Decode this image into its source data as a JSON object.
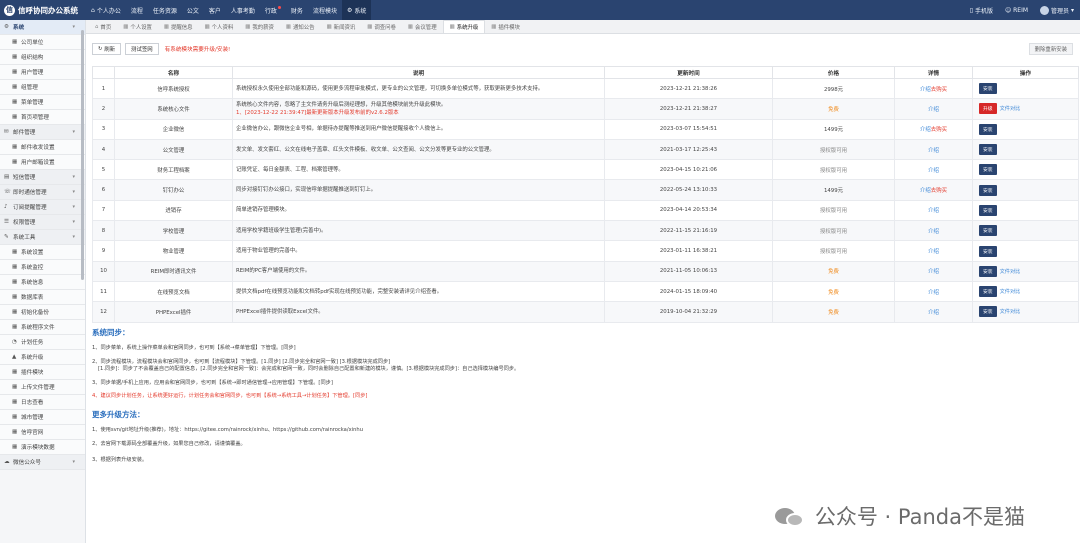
{
  "brand": {
    "name": "信呼协同办公系统",
    "logo_char": "信"
  },
  "topnav": [
    {
      "icon": "⌂",
      "label": "个人办公",
      "active": false
    },
    {
      "icon": "",
      "label": "流程",
      "active": false
    },
    {
      "icon": "",
      "label": "任务资源",
      "active": false
    },
    {
      "icon": "",
      "label": "公文",
      "active": false
    },
    {
      "icon": "",
      "label": "客户",
      "active": false
    },
    {
      "icon": "",
      "label": "人事考勤",
      "active": false
    },
    {
      "icon": "",
      "label": "行政",
      "active": false,
      "dot": true
    },
    {
      "icon": "",
      "label": "财务",
      "active": false
    },
    {
      "icon": "",
      "label": "流程模块",
      "active": false
    },
    {
      "icon": "⚙",
      "label": "系统",
      "active": true
    }
  ],
  "topright": {
    "mobile": "手机版",
    "reim": "REIM",
    "user": "管理员"
  },
  "sidebar": [
    {
      "type": "group",
      "icon": "⚙",
      "label": "系统",
      "active": true,
      "caret": "▾"
    },
    {
      "type": "sub",
      "icon": "▦",
      "label": "公司单位"
    },
    {
      "type": "sub",
      "icon": "▦",
      "label": "组织结构"
    },
    {
      "type": "sub",
      "icon": "▦",
      "label": "用户管理"
    },
    {
      "type": "sub",
      "icon": "▦",
      "label": "组管理"
    },
    {
      "type": "sub",
      "icon": "▦",
      "label": "菜单管理"
    },
    {
      "type": "sub",
      "icon": "▦",
      "label": "首页项管理"
    },
    {
      "type": "group",
      "icon": "✉",
      "label": "邮件管理",
      "caret": "▾"
    },
    {
      "type": "sub",
      "icon": "▦",
      "label": "邮件收发设置"
    },
    {
      "type": "sub",
      "icon": "▦",
      "label": "用户邮箱设置"
    },
    {
      "type": "group",
      "icon": "▤",
      "label": "短信管理",
      "caret": "▾"
    },
    {
      "type": "group",
      "icon": "☏",
      "label": "即时通信管理",
      "caret": "▾"
    },
    {
      "type": "group",
      "icon": "♪",
      "label": "订阅提醒管理",
      "caret": "▾"
    },
    {
      "type": "group",
      "icon": "☰",
      "label": "权限管理",
      "caret": "▾"
    },
    {
      "type": "group",
      "icon": "✎",
      "label": "系统工具",
      "caret": "▾"
    },
    {
      "type": "sub",
      "icon": "▦",
      "label": "系统设置"
    },
    {
      "type": "sub",
      "icon": "▦",
      "label": "系统监控"
    },
    {
      "type": "sub",
      "icon": "▦",
      "label": "系统信息"
    },
    {
      "type": "sub",
      "icon": "▦",
      "label": "数据库表"
    },
    {
      "type": "sub",
      "icon": "▦",
      "label": "初始化备份"
    },
    {
      "type": "sub",
      "icon": "▦",
      "label": "系统程序文件"
    },
    {
      "type": "sub",
      "icon": "◔",
      "label": "计划任务"
    },
    {
      "type": "sub",
      "icon": "▲",
      "label": "系统升级"
    },
    {
      "type": "sub",
      "icon": "▦",
      "label": "插件模块"
    },
    {
      "type": "sub",
      "icon": "▦",
      "label": "上传文件管理"
    },
    {
      "type": "sub",
      "icon": "▦",
      "label": "日志查看"
    },
    {
      "type": "sub",
      "icon": "▦",
      "label": "城市管理"
    },
    {
      "type": "sub",
      "icon": "▦",
      "label": "信呼官网"
    },
    {
      "type": "sub",
      "icon": "▦",
      "label": "演示模块数据"
    },
    {
      "type": "group",
      "icon": "☁",
      "label": "微信公众号",
      "caret": "▾"
    }
  ],
  "tabs": [
    {
      "icon": "⌂",
      "label": "首页",
      "active": false
    },
    {
      "icon": "▦",
      "label": "个人设置",
      "active": false
    },
    {
      "icon": "▦",
      "label": "提醒信息",
      "active": false
    },
    {
      "icon": "▦",
      "label": "个人资料",
      "active": false
    },
    {
      "icon": "▦",
      "label": "我的薪资",
      "active": false
    },
    {
      "icon": "▦",
      "label": "通知公告",
      "active": false
    },
    {
      "icon": "▦",
      "label": "新闻资讯",
      "active": false
    },
    {
      "icon": "▦",
      "label": "调查问卷",
      "active": false
    },
    {
      "icon": "▦",
      "label": "会议管理",
      "active": false
    },
    {
      "icon": "▦",
      "label": "系统升级",
      "active": true
    },
    {
      "icon": "▦",
      "label": "插件模块",
      "active": false
    }
  ],
  "toolbar": {
    "refresh_label": "刷新",
    "test_label": "测试签网",
    "warning": "有系统模块需要升级/安装!",
    "delete_label": "删除重新安装"
  },
  "table": {
    "headers": [
      "",
      "名称",
      "说明",
      "更新时间",
      "价格",
      "详情",
      "操作"
    ],
    "rows": [
      {
        "no": "1",
        "name": "信呼系统授权",
        "desc": "系统授权永久使用全部功能和源码，使用更多流程审批模式，更专业的公文管理，可切换多单位模式等，获取更新更多技术支持。",
        "note": "",
        "time": "2023-12-21 21:38:26",
        "price": "2998元",
        "price_type": "normal",
        "detail": "介绍",
        "buy": "去购买",
        "action": "安装",
        "compare": ""
      },
      {
        "no": "2",
        "name": "系统核心文件",
        "desc": "系统核心文件内容，忽略了主文件请务升级后测经理想，升级其他模块前先升级此模块。",
        "note": "1、[2023-12-22 21:39:47]最新更新版本升级发布前的v2.6.2版本",
        "time": "2023-12-21 21:38:27",
        "price": "免费",
        "price_type": "free",
        "detail": "介绍",
        "buy": "",
        "action": "升级",
        "compare": "文件对比"
      },
      {
        "no": "3",
        "name": "企业微信",
        "desc": "企业微信办公，跟微信企业号相，单据待办提醒等推送到用户微信提醒接收个人微信上。",
        "note": "",
        "time": "2023-03-07 15:54:51",
        "price": "1499元",
        "price_type": "normal",
        "detail": "介绍",
        "buy": "去购买",
        "action": "安装",
        "compare": ""
      },
      {
        "no": "4",
        "name": "公文管理",
        "desc": "发文单、发文套红、公文在线电子盖章、红头文件模板、收文单、公文查阅、公文分发等更专业的公文管理。",
        "note": "",
        "time": "2021-03-17 12:25:43",
        "price": "授权版可用",
        "price_type": "grey",
        "detail": "介绍",
        "buy": "",
        "action": "安装",
        "compare": ""
      },
      {
        "no": "5",
        "name": "财务工程档案",
        "desc": "记账凭证、每日金额表、工程、档案管理等。",
        "note": "",
        "time": "2023-04-15 10:21:06",
        "price": "授权版可用",
        "price_type": "grey",
        "detail": "介绍",
        "buy": "",
        "action": "安装",
        "compare": ""
      },
      {
        "no": "6",
        "name": "钉钉办公",
        "desc": "同步对接钉钉办公接口，实现信呼单据提醒推送到钉钉上。",
        "note": "",
        "time": "2022-05-24 13:10:33",
        "price": "1499元",
        "price_type": "normal",
        "detail": "介绍",
        "buy": "去购买",
        "action": "安装",
        "compare": ""
      },
      {
        "no": "7",
        "name": "进销存",
        "desc": "简单进销存管理模块。",
        "note": "",
        "time": "2023-04-14 20:53:34",
        "price": "授权版可用",
        "price_type": "grey",
        "detail": "介绍",
        "buy": "",
        "action": "安装",
        "compare": ""
      },
      {
        "no": "8",
        "name": "学校管理",
        "desc": "适用学校学籍班级学生管理(完善中)。",
        "note": "",
        "time": "2022-11-15 21:16:19",
        "price": "授权版可用",
        "price_type": "grey",
        "detail": "介绍",
        "buy": "",
        "action": "安装",
        "compare": ""
      },
      {
        "no": "9",
        "name": "物业管理",
        "desc": "适用于物业管理的完善中。",
        "note": "",
        "time": "2023-01-11 16:38:21",
        "price": "授权版可用",
        "price_type": "grey",
        "detail": "介绍",
        "buy": "",
        "action": "安装",
        "compare": ""
      },
      {
        "no": "10",
        "name": "REIM即时通讯文件",
        "desc": "REIM的PC客户端使用的文件。",
        "note": "",
        "time": "2021-11-05 10:06:13",
        "price": "免费",
        "price_type": "free",
        "detail": "介绍",
        "buy": "",
        "action": "安装",
        "compare": "文件对比"
      },
      {
        "no": "11",
        "name": "在线预览文档",
        "desc": "提供文档pdf在线预览功能和文档转pdf实现在线预览功能，完整安装请详见介绍查看。",
        "note": "",
        "time": "2024-01-15 18:09:40",
        "price": "免费",
        "price_type": "free",
        "detail": "介绍",
        "buy": "",
        "action": "安装",
        "compare": "文件对比"
      },
      {
        "no": "12",
        "name": "PHPExcel插件",
        "desc": "PHPExcel插件提供读取Excel文件。",
        "note": "",
        "time": "2019-10-04 21:32:29",
        "price": "免费",
        "price_type": "free",
        "detail": "介绍",
        "buy": "",
        "action": "安装",
        "compare": "文件对比"
      }
    ]
  },
  "sync": {
    "title": "系统同步：",
    "line1": "1、同步菜单，系统上操作菜单会和官网同步，也可到【系统→菜单管理】下管理。[同步]",
    "line2": "2、同步流程模块，流程模块会和官网同步，也可到【流程模块】下管理。[1.同步] [2.同步完全和官网一致] [3.根据模块完成同步]",
    "line2b": "[1.同步]：同步了不会覆盖自己的配置信息，[2.同步完全和官网一致]：会完成和官网一致，同时会删除自己配置和新建的模块，谨慎。[3.根据模块完成同步]：自己选择模块编号同步。",
    "line3": "3、同步单据/手机上应用，应用会和官网同步，也可到【系统→即时通信管理→应用管理】下管理。[同步]",
    "line4": "4、建议同步计划任务，让系统更好运行，计划任务会和官网同步，也可到【系统→系统工具→计划任务】下管理。[同步]"
  },
  "more": {
    "title": "更多升级方法：",
    "line1": "1、使用svn/git地址升级(推荐)，地址：https://gitee.com/rainrock/xinhu、https://github.com/rainrocka/xinhu",
    "line2": "2、去官网下载源码全部覆盖升级，如果您自己修改，请谨慎覆盖。",
    "line3": "3、根据列表升级安装。"
  },
  "watermark": {
    "text": "公众号 · Panda不是猫"
  },
  "colors": {
    "nav": "#2a4470",
    "accent": "#2a6ebd",
    "danger": "#e33a2c",
    "free": "#f08a1c"
  }
}
